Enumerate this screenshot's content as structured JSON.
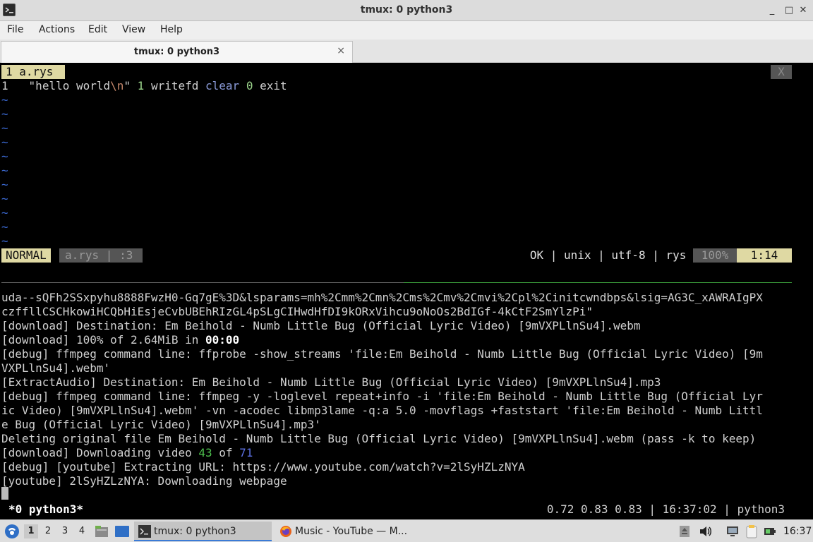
{
  "window": {
    "title": "tmux: 0 python3",
    "minimize": "_",
    "maximize": "□",
    "close": "✕"
  },
  "menu": [
    "File",
    "Actions",
    "Edit",
    "View",
    "Help"
  ],
  "tab": {
    "label": "tmux: 0 python3",
    "close": "×"
  },
  "vim": {
    "tab_label": "1 a.rys",
    "close_label": "X",
    "line_number": "1",
    "code": {
      "str_open": "\"hello world",
      "escape": "\\n",
      "str_close": "\" ",
      "num1": "1",
      "sp1": " writefd ",
      "kw_clear": "clear",
      "sp2": " ",
      "num2": "0",
      "sp3": " exit"
    },
    "tilde": "~",
    "status": {
      "mode": "NORMAL",
      "file": "a.rys | :3",
      "right": "OK | unix | utf-8 | rys ",
      "percent": "100%",
      "position": "1:14"
    }
  },
  "output": [
    "uda--sQFh2SSxpyhu8888FwzH0-Gq7gE%3D&lsparams=mh%2Cmm%2Cmn%2Cms%2Cmv%2Cmvi%2Cpl%2Cinitcwndbps&lsig=AG3C_xAWRAIgPX",
    "czffllCSCHkowiHCQbHiEsjeCvbUBEhRIzGL4pSLgCIHwdHfDI9kORxVihcu9oNoOs2BdIGf-4kCtF2SmYlzPi\"",
    "[download] Destination: Em Beihold - Numb Little Bug (Official Lyric Video) [9mVXPLlnSu4].webm",
    "",
    "[debug] ffmpeg command line: ffprobe -show_streams 'file:Em Beihold - Numb Little Bug (Official Lyric Video) [9m",
    "VXPLlnSu4].webm'",
    "[ExtractAudio] Destination: Em Beihold - Numb Little Bug (Official Lyric Video) [9mVXPLlnSu4].mp3",
    "[debug] ffmpeg command line: ffmpeg -y -loglevel repeat+info -i 'file:Em Beihold - Numb Little Bug (Official Lyr",
    "ic Video) [9mVXPLlnSu4].webm' -vn -acodec libmp3lame -q:a 5.0 -movflags +faststart 'file:Em Beihold - Numb Littl",
    "e Bug (Official Lyric Video) [9mVXPLlnSu4].mp3'",
    "Deleting original file Em Beihold - Numb Little Bug (Official Lyric Video) [9mVXPLlnSu4].webm (pass -k to keep)",
    "",
    "[debug] [youtube] Extracting URL: https://www.youtube.com/watch?v=2lSyHZLzNYA",
    "[youtube] 2lSyHZLzNYA: Downloading webpage"
  ],
  "progress_line": {
    "prefix": "[download] 100% of 2.64MiB in ",
    "time": "00:00"
  },
  "downloading_line": {
    "prefix": "[download] Downloading video ",
    "current": "43",
    "mid": " of ",
    "total": "71"
  },
  "tmux": {
    "window": "*0 python3*",
    "status_right": "0.72 0.83 0.83 | 16:37:02 | python3"
  },
  "taskbar": {
    "workspaces": [
      "1",
      "2",
      "3",
      "4"
    ],
    "tasks": [
      {
        "label": "tmux: 0 python3",
        "active": true
      },
      {
        "label": "Music - YouTube — M...",
        "active": false
      }
    ],
    "clock": "16:37"
  },
  "colors": {
    "vim_accent": "#dfd9a3",
    "vim_muted": "#555555",
    "tilde": "#3c6bd6",
    "taskbar_bg": "#dedede"
  }
}
